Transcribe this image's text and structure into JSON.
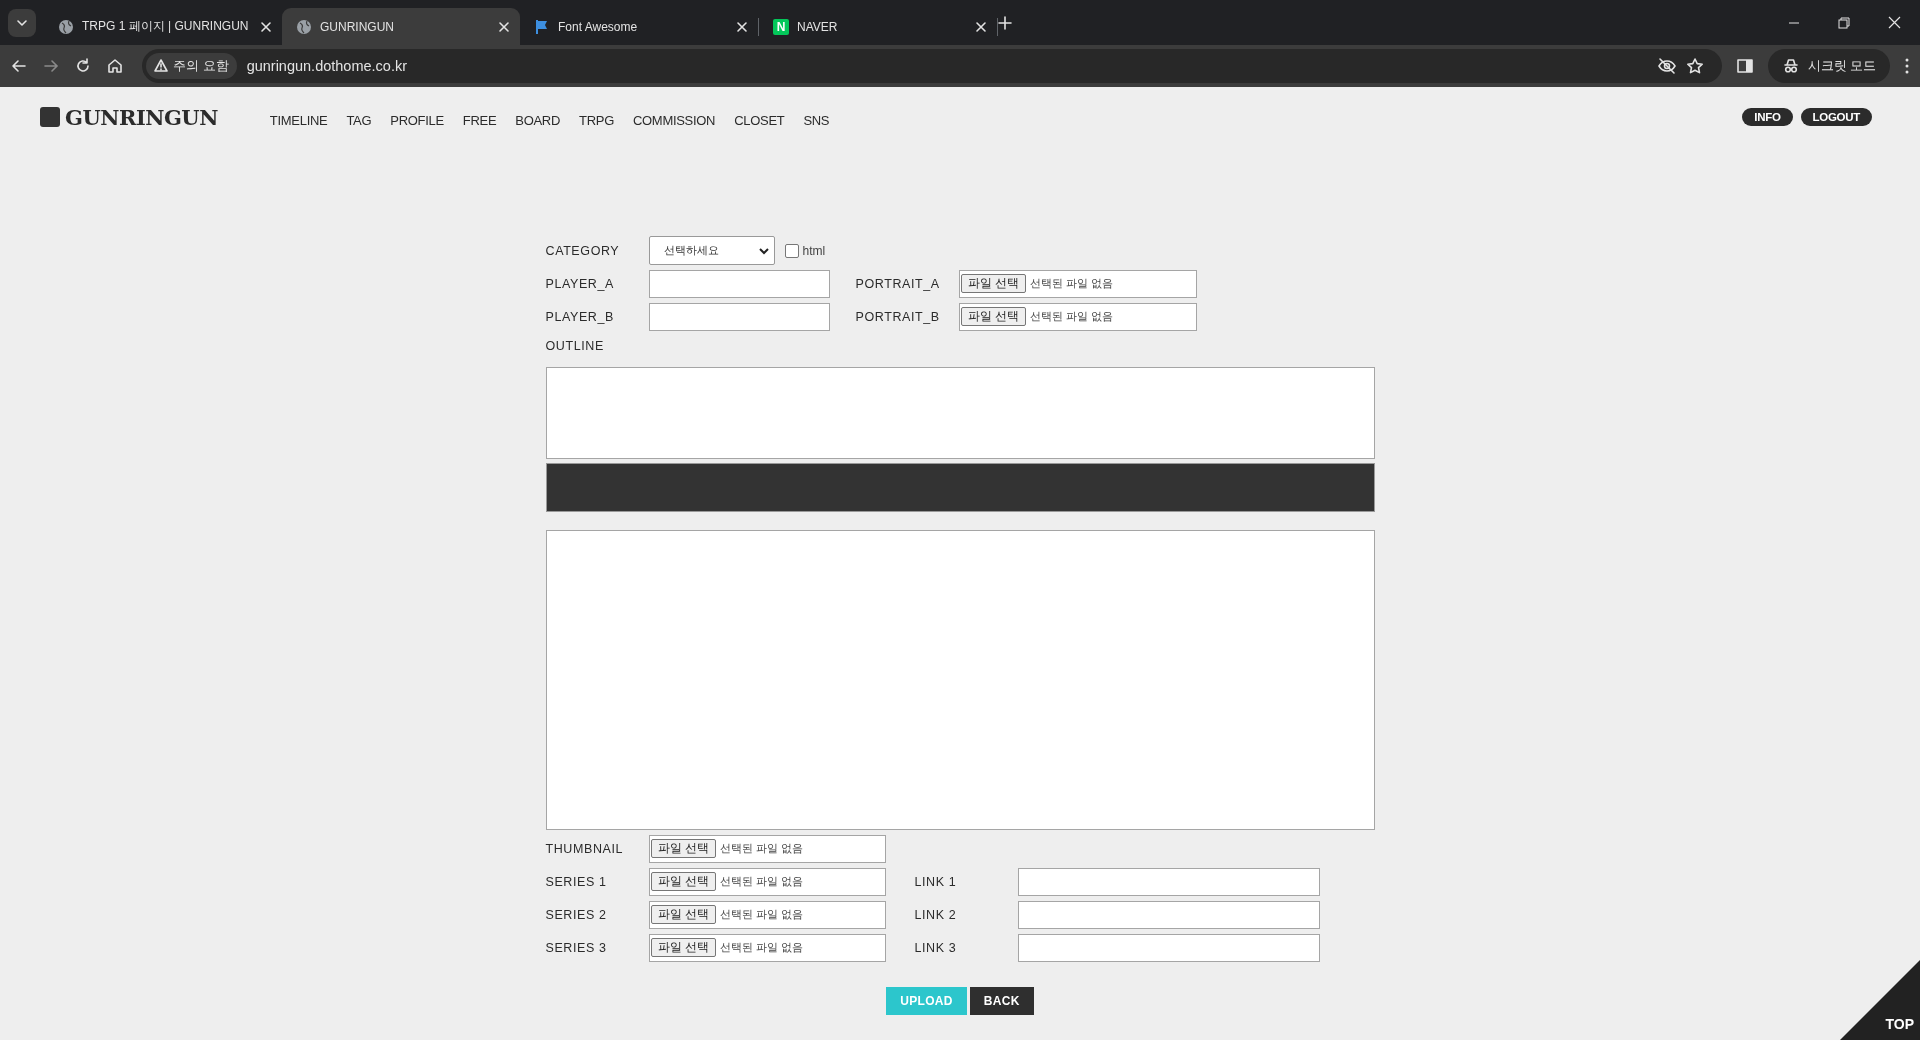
{
  "browser": {
    "tabs": [
      {
        "title": "TRPG 1 페이지 | GUNRINGUN",
        "kind": "globe",
        "selected": false
      },
      {
        "title": "GUNRINGUN",
        "kind": "globe",
        "selected": true
      },
      {
        "title": "Font Awesome",
        "kind": "flag",
        "selected": false
      },
      {
        "title": "NAVER",
        "kind": "badge",
        "badge": "N",
        "selected": false
      }
    ],
    "security_chip": "주의 요함",
    "url": "gunringun.dothome.co.kr",
    "profile_chip": "시크릿 모드"
  },
  "header": {
    "logo": "GUNRINGUN",
    "nav": [
      "TIMELINE",
      "TAG",
      "PROFILE",
      "FREE",
      "BOARD",
      "TRPG",
      "COMMISSION",
      "CLOSET",
      "SNS"
    ],
    "buttons": [
      "INFO",
      "LOGOUT"
    ]
  },
  "form": {
    "category": {
      "label": "CATEGORY",
      "value": "선택하세요"
    },
    "html_option": {
      "label": "html",
      "checked": false
    },
    "players": [
      {
        "label": "PLAYER_A",
        "portrait_label": "PORTRAIT_A",
        "file_button": "파일 선택",
        "file_status": "선택된 파일 없음"
      },
      {
        "label": "PLAYER_B",
        "portrait_label": "PORTRAIT_B",
        "file_button": "파일 선택",
        "file_status": "선택된 파일 없음"
      }
    ],
    "outline_label": "OUTLINE",
    "thumbnail": {
      "label": "THUMBNAIL",
      "file_button": "파일 선택",
      "file_status": "선택된 파일 없음"
    },
    "series": [
      {
        "label": "SERIES 1",
        "file_button": "파일 선택",
        "file_status": "선택된 파일 없음",
        "link_label": "LINK 1"
      },
      {
        "label": "SERIES 2",
        "file_button": "파일 선택",
        "file_status": "선택된 파일 없음",
        "link_label": "LINK 2"
      },
      {
        "label": "SERIES 3",
        "file_button": "파일 선택",
        "file_status": "선택된 파일 없음",
        "link_label": "LINK 3"
      }
    ],
    "buttons": [
      {
        "label": "UPLOAD",
        "kind": "primary"
      },
      {
        "label": "BACK",
        "kind": "dark"
      }
    ]
  },
  "top_button": "TOP"
}
